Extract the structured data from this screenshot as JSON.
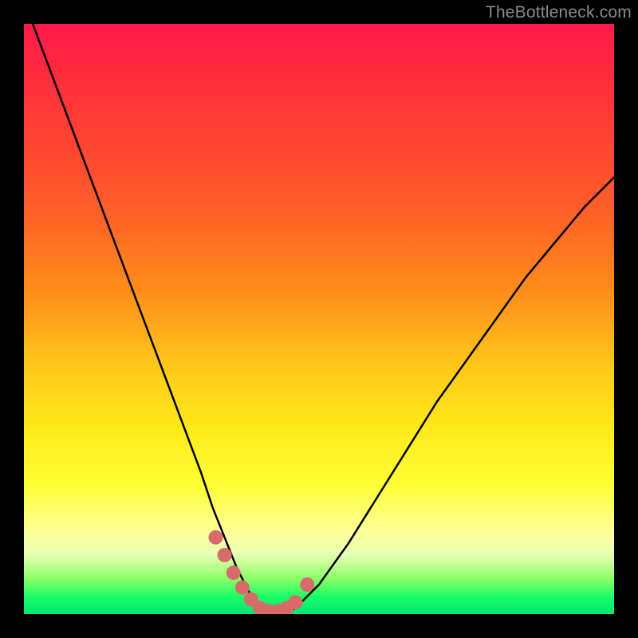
{
  "watermark": "TheBottleneck.com",
  "colors": {
    "frame": "#000000",
    "curve_stroke": "#000000",
    "dot_fill": "#d86a6a",
    "gradient_stops": [
      "#ff1a4d",
      "#ff2a3d",
      "#ff5a2a",
      "#ff8c1a",
      "#ffc81a",
      "#ffe81a",
      "#ffff33",
      "#ffff99",
      "#e6ffb3",
      "#8cff66",
      "#1aff66",
      "#00e673"
    ]
  },
  "chart_data": {
    "type": "line",
    "title": "",
    "xlabel": "",
    "ylabel": "",
    "xlim": [
      0,
      100
    ],
    "ylim": [
      0,
      100
    ],
    "series": [
      {
        "name": "bottleneck-curve",
        "x": [
          0,
          3,
          6,
          9,
          12,
          15,
          18,
          21,
          24,
          27,
          30,
          32,
          34,
          36,
          38,
          40,
          42,
          44,
          46,
          50,
          55,
          60,
          65,
          70,
          75,
          80,
          85,
          90,
          95,
          100
        ],
        "y": [
          104,
          96,
          88,
          80,
          72,
          64,
          56,
          48,
          40,
          32,
          24,
          18,
          13,
          8,
          4,
          1,
          0,
          0,
          1,
          5,
          12,
          20,
          28,
          36,
          43,
          50,
          57,
          63,
          69,
          74
        ]
      }
    ],
    "dots": {
      "name": "highlight-dots",
      "x": [
        32.5,
        34,
        35.5,
        37,
        38.5,
        40,
        41.5,
        43,
        44.5,
        46,
        48
      ],
      "y": [
        13,
        10,
        7,
        4.5,
        2.5,
        1,
        0.5,
        0.5,
        1,
        2,
        5
      ]
    }
  }
}
